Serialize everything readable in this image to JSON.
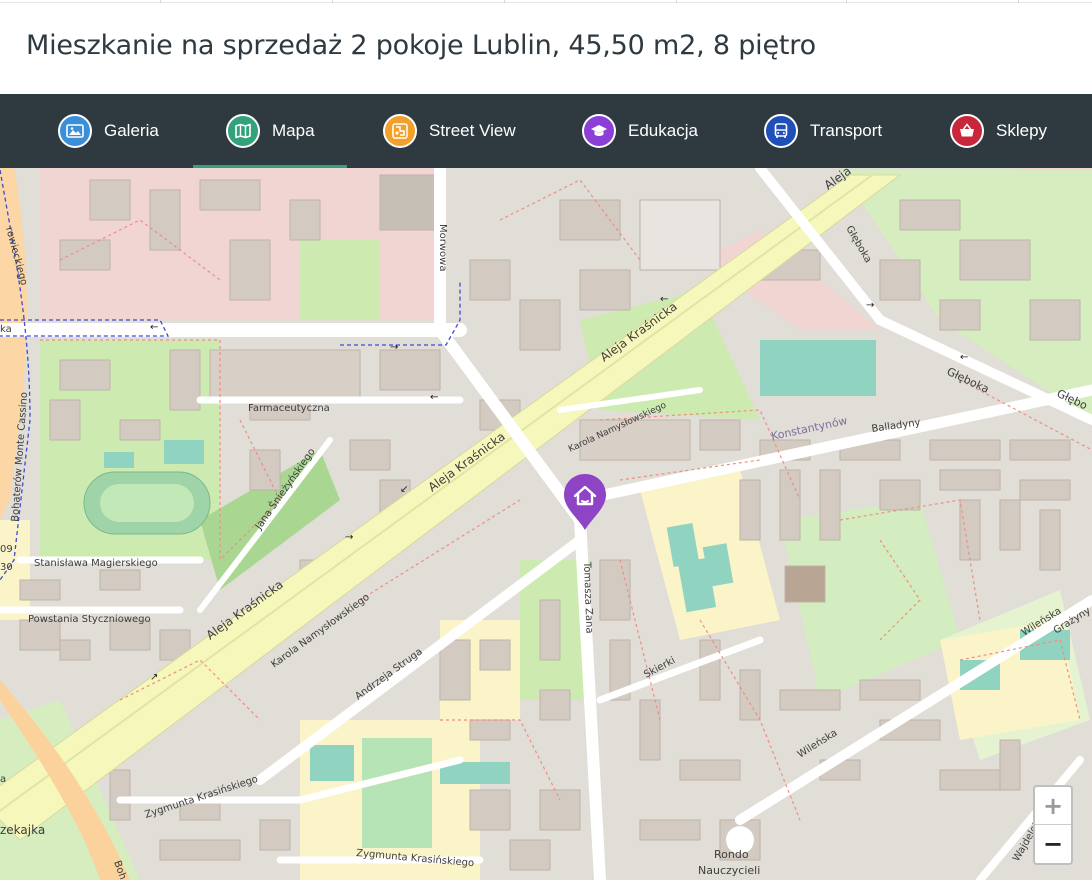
{
  "listing": {
    "title": "Mieszkanie na sprzedaż 2 pokoje Lublin, 45,50 m2, 8 piętro"
  },
  "tabs": [
    {
      "label": "Galeria",
      "icon": "image-icon",
      "color": "#3b8fd9",
      "active": false
    },
    {
      "label": "Mapa",
      "icon": "map-icon",
      "color": "#31a27a",
      "active": true
    },
    {
      "label": "Street View",
      "icon": "street-view-icon",
      "color": "#f2a02a",
      "active": false
    },
    {
      "label": "Edukacja",
      "icon": "graduation-cap-icon",
      "color": "#8c3fd6",
      "active": false
    },
    {
      "label": "Transport",
      "icon": "bus-icon",
      "color": "#1f4fb8",
      "active": false
    },
    {
      "label": "Sklepy",
      "icon": "shopping-basket-icon",
      "color": "#c8263a",
      "active": false
    }
  ],
  "map": {
    "marker_icon": "home-marker-icon",
    "marker_color": "#8e44c4",
    "zoom_in": "+",
    "zoom_out": "−",
    "streets": {
      "aleja_top": "Aleja Kraśnicka",
      "aleja_mid": "Aleja Kraśnicka",
      "aleja_bottom": "Aleja Kraśnicka",
      "aleja_ne": "Aleja",
      "morwowa": "Morwowa",
      "glebokа_n": "Głęboka",
      "gleboka_e": "Głęboka",
      "gleboka_far": "Głębo",
      "farmaceutyczna": "Farmaceutyczna",
      "namyslowskiego_n": "Karola Namysłowskiego",
      "namyslowskiego_s": "Karola Namysłowskiego",
      "konstantynow": "Konstantynów",
      "balladyny": "Balladyny",
      "sniezynskiego": "Jana Śnieżyńskiego",
      "magierskiego": "Stanisława Magierskiego",
      "powstania": "Powstania Styczniowego",
      "struga": "Andrzeja Struga",
      "zana": "Tomasza Zana",
      "skierki": "Skierki",
      "wilenska_e": "Wileńska",
      "wilenska_s": "Wileńska",
      "grazyny": "Grażyny",
      "wajdeloty": "Wajdeloty",
      "krasinskiego_1": "Zygmunta Krasińskiego",
      "krasinskiego_2": "Zygmunta Krasińskiego",
      "monte_cassino": "Bohaterów Monte Cassino",
      "rondo_1": "Rondo",
      "rondo_2": "Nauczycieli",
      "bystrzyca": "zekajka",
      "left_ka": "ka",
      "left_dowieckiego": "rowieckiego",
      "left_09": "09",
      "left_30": "30",
      "left_a": "a",
      "bottom_boh": "Boh"
    }
  }
}
